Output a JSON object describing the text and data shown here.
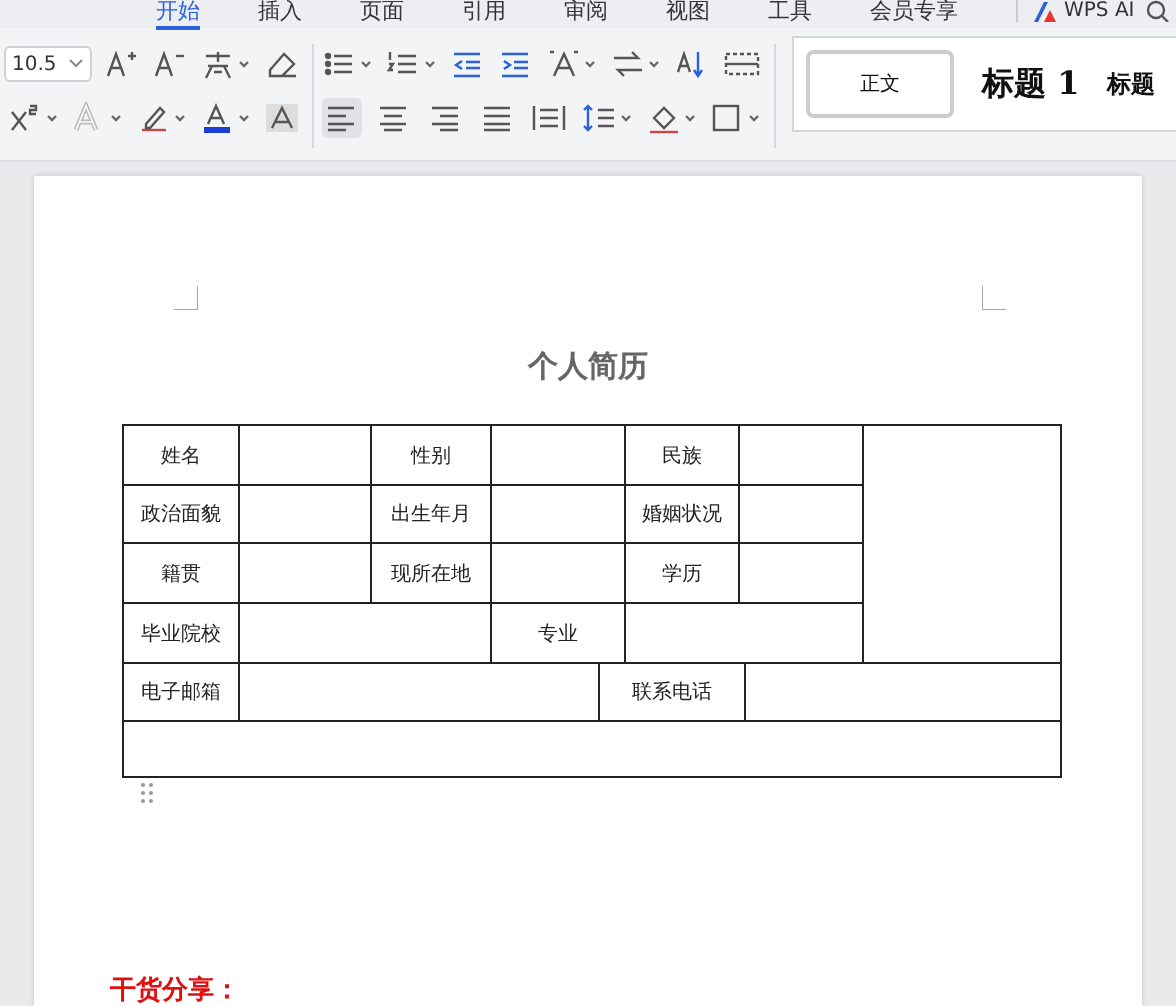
{
  "tabs": [
    {
      "label": "开始",
      "selected": true
    },
    {
      "label": "插入",
      "selected": false
    },
    {
      "label": "页面",
      "selected": false
    },
    {
      "label": "引用",
      "selected": false
    },
    {
      "label": "审阅",
      "selected": false
    },
    {
      "label": "视图",
      "selected": false
    },
    {
      "label": "工具",
      "selected": false
    },
    {
      "label": "会员专享",
      "selected": false
    }
  ],
  "ai_button": {
    "label": "WPS AI"
  },
  "font_size": {
    "value": "10.5"
  },
  "alignment": [
    {
      "kind": "left",
      "selected": true
    },
    {
      "kind": "center",
      "selected": false
    },
    {
      "kind": "right",
      "selected": false
    },
    {
      "kind": "justify",
      "selected": false
    },
    {
      "kind": "distribute",
      "selected": false
    }
  ],
  "styles": [
    {
      "label": "正文",
      "selected": true,
      "kind": "body"
    },
    {
      "label": "标题 1",
      "selected": false,
      "kind": "h1"
    },
    {
      "label": "标题",
      "selected": false,
      "kind": "h2"
    }
  ],
  "document": {
    "title": "个人简历",
    "table": {
      "rows": [
        [
          "姓名",
          "",
          "性别",
          "",
          "民族",
          "",
          ""
        ],
        [
          "政治面貌",
          "",
          "出生年月",
          "",
          "婚姻状况",
          ""
        ],
        [
          "籍贯",
          "",
          "现所在地",
          "",
          "学历",
          ""
        ],
        [
          "毕业院校",
          "",
          "",
          "专业",
          "",
          ""
        ],
        [
          "电子邮箱",
          "",
          "",
          "",
          "联系电话",
          ""
        ],
        [
          ""
        ]
      ]
    },
    "footer_heading": "干货分享："
  }
}
